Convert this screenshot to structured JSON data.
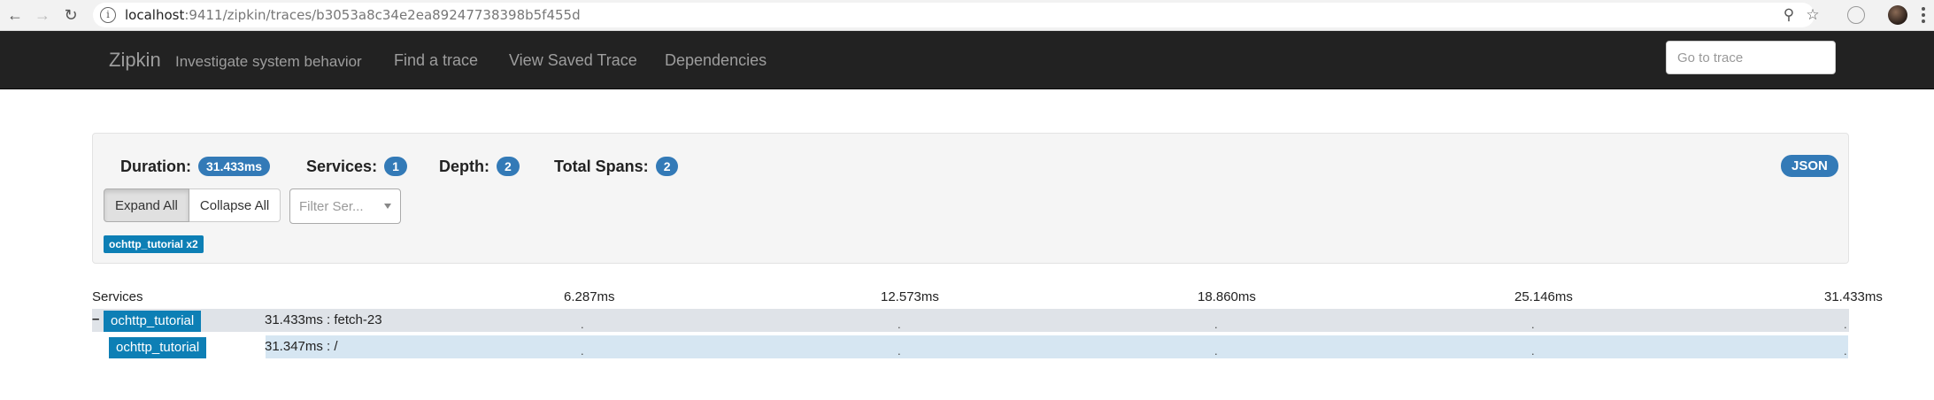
{
  "browser": {
    "url_host": "localhost",
    "url_rest": ":9411/zipkin/traces/b3053a8c34e2ea89247738398b5f455d"
  },
  "navbar": {
    "brand": "Zipkin",
    "tagline": "Investigate system behavior",
    "links": [
      "Find a trace",
      "View Saved Trace",
      "Dependencies"
    ],
    "goto_placeholder": "Go to trace"
  },
  "summary": {
    "duration_label": "Duration:",
    "duration_value": "31.433ms",
    "services_label": "Services:",
    "services_value": "1",
    "depth_label": "Depth:",
    "depth_value": "2",
    "total_spans_label": "Total Spans:",
    "total_spans_value": "2",
    "json_label": "JSON",
    "expand_all": "Expand All",
    "collapse_all": "Collapse All",
    "filter_placeholder": "Filter Ser...",
    "service_tag": "ochttp_tutorial x2"
  },
  "timeline": {
    "services_header": "Services",
    "ticks": [
      "6.287ms",
      "12.573ms",
      "18.860ms",
      "25.146ms",
      "31.433ms"
    ],
    "spans": [
      {
        "toggle": "–",
        "service": "ochttp_tutorial",
        "label": "31.433ms : fetch-23"
      },
      {
        "toggle": "",
        "service": "ochttp_tutorial",
        "label": "31.347ms : /"
      }
    ]
  },
  "colors": {
    "navbar_bg": "#222222",
    "badge_blue": "#337ab7",
    "service_blue": "#0d7fb5",
    "row1_bg": "#dfe3e8",
    "row2_bg": "#d6e6f2"
  }
}
